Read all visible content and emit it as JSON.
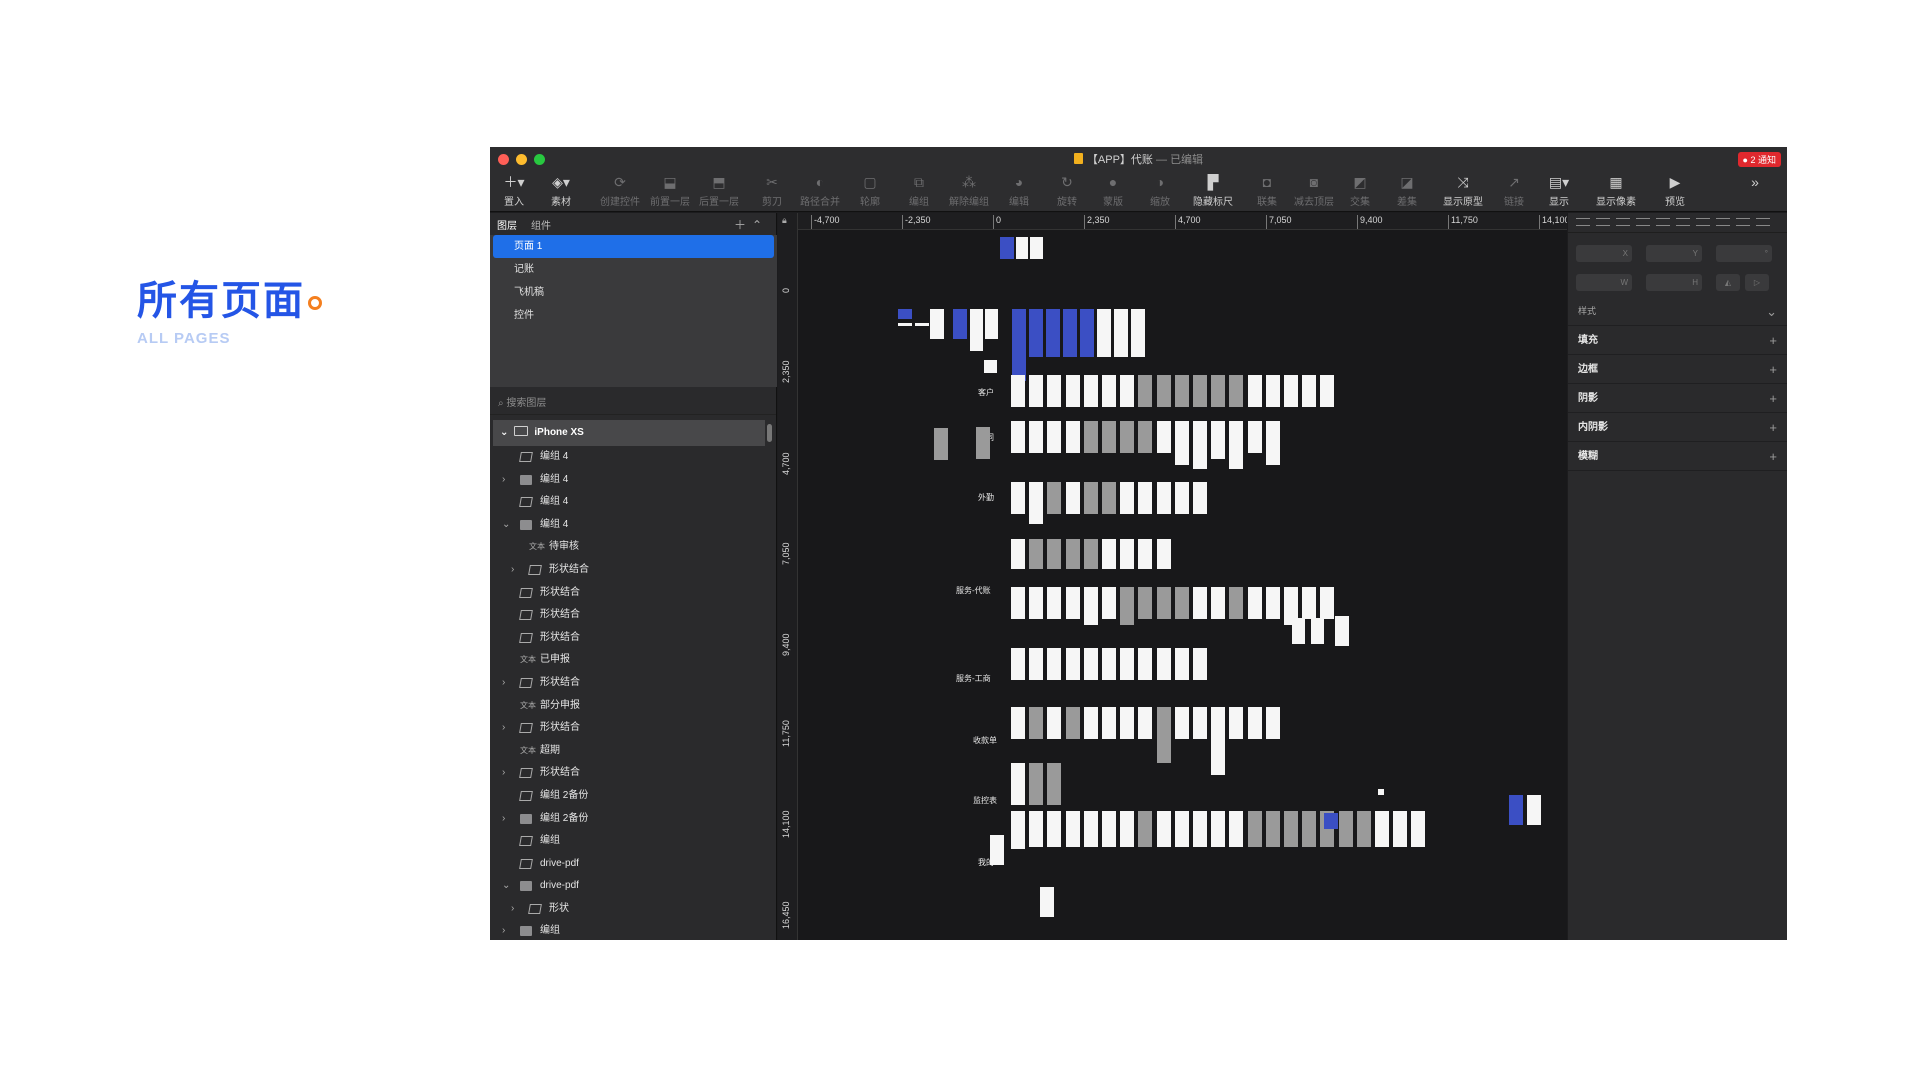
{
  "heading": {
    "title": "所有页面",
    "subtitle": "ALL PAGES"
  },
  "window": {
    "title": "【APP】代账",
    "separator": "—",
    "edited_status": "已编辑",
    "notification": "● 2 通知",
    "lights": [
      "#ff5f57",
      "#febc2e",
      "#28c840"
    ]
  },
  "toolbar": {
    "insert": "置入",
    "assets": "素材",
    "create_symbol": "创建控件",
    "bring_forward": "前置一层",
    "send_backward": "后置一层",
    "scissors": "剪刀",
    "path_merge": "路径合并",
    "outline": "轮廓",
    "group": "编组",
    "ungroup": "解除编组",
    "edit": "编辑",
    "rotate": "旋转",
    "mask": "蒙版",
    "scale": "缩放",
    "hide_ruler": "隐藏标尺",
    "union": "联集",
    "subtract": "减去顶层",
    "intersect": "交集",
    "difference": "差集",
    "show_prototype": "显示原型",
    "link": "链接",
    "view": "显示",
    "show_pixels": "显示像素",
    "preview": "预览"
  },
  "left_panel": {
    "tab_layers": "图层",
    "tab_components": "组件",
    "pages": [
      {
        "label": "页面 1",
        "selected": true
      },
      {
        "label": "记账",
        "selected": false
      },
      {
        "label": "飞机稿",
        "selected": false
      },
      {
        "label": "控件",
        "selected": false
      }
    ],
    "search_placeholder": "搜索图层",
    "artboard": "iPhone XS",
    "text_tag": "文本",
    "layers": [
      {
        "name": "编组 4",
        "type": "shape",
        "indent": 0,
        "expand": ""
      },
      {
        "name": "编组 4",
        "type": "folder",
        "indent": 0,
        "expand": "›"
      },
      {
        "name": "编组 4",
        "type": "shape",
        "indent": 0,
        "expand": ""
      },
      {
        "name": "编组 4",
        "type": "folder",
        "indent": 0,
        "expand": "⌄"
      },
      {
        "name": "待审核",
        "type": "text",
        "indent": 1,
        "expand": ""
      },
      {
        "name": "形状结合",
        "type": "shape",
        "indent": 1,
        "expand": "›"
      },
      {
        "name": "形状结合",
        "type": "shape",
        "indent": 0,
        "expand": ""
      },
      {
        "name": "形状结合",
        "type": "shape",
        "indent": 0,
        "expand": ""
      },
      {
        "name": "形状结合",
        "type": "shape",
        "indent": 0,
        "expand": ""
      },
      {
        "name": "已申报",
        "type": "text",
        "indent": 0,
        "expand": ""
      },
      {
        "name": "形状结合",
        "type": "shape",
        "indent": 0,
        "expand": "›"
      },
      {
        "name": "部分申报",
        "type": "text",
        "indent": 0,
        "expand": ""
      },
      {
        "name": "形状结合",
        "type": "shape",
        "indent": 0,
        "expand": "›"
      },
      {
        "name": "超期",
        "type": "text",
        "indent": 0,
        "expand": ""
      },
      {
        "name": "形状结合",
        "type": "shape",
        "indent": 0,
        "expand": "›"
      },
      {
        "name": "编组 2备份",
        "type": "shape",
        "indent": 0,
        "expand": ""
      },
      {
        "name": "编组 2备份",
        "type": "folder",
        "indent": 0,
        "expand": "›"
      },
      {
        "name": "编组",
        "type": "shape",
        "indent": 0,
        "expand": ""
      },
      {
        "name": "drive-pdf",
        "type": "shape",
        "indent": 0,
        "expand": ""
      },
      {
        "name": "drive-pdf",
        "type": "folder",
        "indent": 0,
        "expand": "⌄"
      },
      {
        "name": "形状",
        "type": "shape",
        "indent": 1,
        "expand": "›"
      },
      {
        "name": "编组",
        "type": "folder",
        "indent": 0,
        "expand": "›"
      }
    ]
  },
  "canvas": {
    "ruler_x": [
      "-4,700",
      "-2,350",
      "0",
      "2,350",
      "4,700",
      "7,050",
      "9,400",
      "11,750",
      "14,100"
    ],
    "ruler_y": [
      "0",
      "2,350",
      "4,700",
      "7,050",
      "9,400",
      "11,750",
      "14,100",
      "16,450"
    ],
    "sections": [
      "客户",
      "合同",
      "外勤",
      "服务-代账",
      "服务-工商",
      "收款单",
      "监控表",
      "我的"
    ]
  },
  "inspector": {
    "fields": [
      "X",
      "Y",
      "°",
      "W",
      "H"
    ],
    "style_label": "样式",
    "fill": "填充",
    "border": "边框",
    "shadow": "阴影",
    "inner_shadow": "内阴影",
    "blur": "模糊"
  }
}
